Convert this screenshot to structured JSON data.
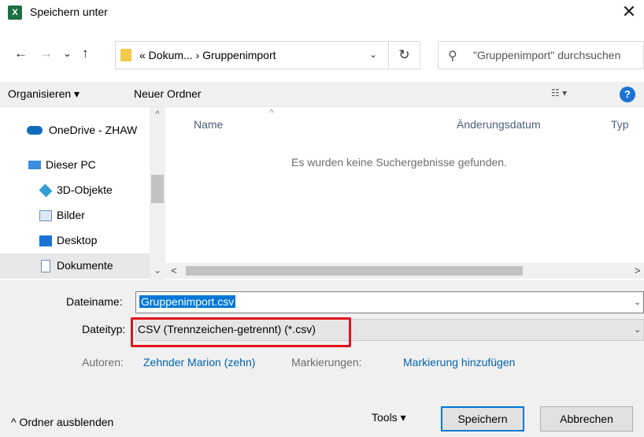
{
  "window": {
    "title": "Speichern unter",
    "app_icon": "X",
    "close_glyph": "✕"
  },
  "nav": {
    "back_glyph": "←",
    "forward_glyph": "→",
    "recent_glyph": "⌄",
    "up_glyph": "↑",
    "address": "«  Dokum...  ›  Gruppenimport",
    "address_dropdown": "⌄",
    "refresh_glyph": "↻",
    "search_placeholder": "\"Gruppenimport\" durchsuchen"
  },
  "toolbar": {
    "organize_label": "Organisieren ▾",
    "new_folder_label": "Neuer Ordner",
    "view_label": "☷ ▾",
    "help_label": "?"
  },
  "sidebar": {
    "items": [
      {
        "label": "OneDrive - ZHAW",
        "icon": "cloud-icon",
        "color": "#0f6cbd"
      },
      {
        "label": "Dieser PC",
        "icon": "computer-icon",
        "color": "#3b8de0"
      },
      {
        "label": "3D-Objekte",
        "icon": "cube-icon",
        "color": "#35a0d4"
      },
      {
        "label": "Bilder",
        "icon": "picture-icon",
        "color": "#6e8fb5"
      },
      {
        "label": "Desktop",
        "icon": "desktop-icon",
        "color": "#1a73d5"
      },
      {
        "label": "Dokumente",
        "icon": "document-icon",
        "color": "#7a8aa0"
      }
    ],
    "scroll_up_glyph": "^",
    "scroll_down_glyph": "⌄"
  },
  "filelist": {
    "columns": [
      "Name",
      "Änderungsdatum",
      "Typ"
    ],
    "sort_glyph": "^",
    "empty_message": "Es wurden keine Suchergebnisse gefunden.",
    "hscroll_left": "<",
    "hscroll_right": ">"
  },
  "form": {
    "filename_label": "Dateiname:",
    "filename_value": "Gruppenimport.csv",
    "filetype_label": "Dateityp:",
    "filetype_value": "CSV (Trennzeichen-getrennt) (*.csv)",
    "dropdown_glyph": "⌄",
    "authors_label": "Autoren:",
    "authors_value": "Zehnder Marion (zehn)",
    "tags_label": "Markierungen:",
    "tags_value": "Markierung hinzufügen"
  },
  "footer": {
    "collapse_label": "^  Ordner ausblenden",
    "tools_label": "Tools  ▾",
    "save_label": "Speichern",
    "cancel_label": "Abbrechen"
  },
  "colors": {
    "accent": "#0078d7",
    "highlight": "#e0131e",
    "link": "#0063b1"
  }
}
